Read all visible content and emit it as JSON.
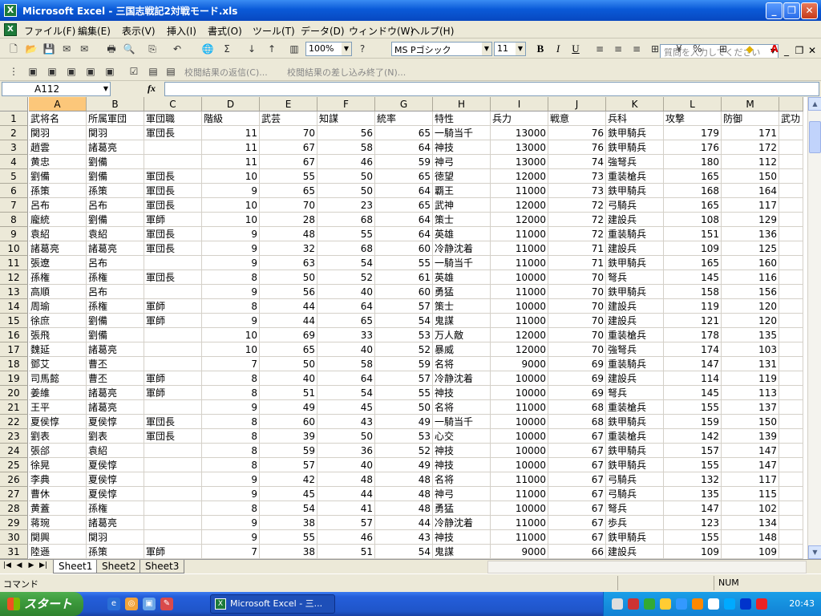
{
  "window": {
    "title": "Microsoft Excel - 三国志戦記2対戦モード.xls"
  },
  "menu": [
    "ファイル(F)",
    "編集(E)",
    "表示(V)",
    "挿入(I)",
    "書式(O)",
    "ツール(T)",
    "データ(D)",
    "ウィンドウ(W)",
    "ヘルプ(H)"
  ],
  "help_placeholder": "質問を入力してください",
  "toolbar": {
    "zoom": "100%",
    "font": "MS Pゴシック",
    "size": "11",
    "review_reply": "校閲結果の返信(C)...",
    "review_end": "校閲結果の差し込み終了(N)..."
  },
  "namebox": "A112",
  "fx": "fx",
  "columns": [
    "A",
    "B",
    "C",
    "D",
    "E",
    "F",
    "G",
    "H",
    "I",
    "J",
    "K",
    "L",
    "M",
    ""
  ],
  "rows": [
    [
      "1",
      "武将名",
      "所属軍団",
      "軍団職",
      "階級",
      "武芸",
      "知謀",
      "統率",
      "特性",
      "兵力",
      "戦意",
      "兵科",
      "攻撃",
      "防御",
      "武功"
    ],
    [
      "2",
      "関羽",
      "関羽",
      "軍団長",
      "11",
      "70",
      "56",
      "65",
      "一騎当千",
      "13000",
      "76",
      "鉄甲騎兵",
      "179",
      "171",
      ""
    ],
    [
      "3",
      "趙雲",
      "諸葛亮",
      "",
      "11",
      "67",
      "58",
      "64",
      "神技",
      "13000",
      "76",
      "鉄甲騎兵",
      "176",
      "172",
      ""
    ],
    [
      "4",
      "黄忠",
      "劉備",
      "",
      "11",
      "67",
      "46",
      "59",
      "神弓",
      "13000",
      "74",
      "強弩兵",
      "180",
      "112",
      ""
    ],
    [
      "5",
      "劉備",
      "劉備",
      "軍団長",
      "10",
      "55",
      "50",
      "65",
      "徳望",
      "12000",
      "73",
      "重装槍兵",
      "165",
      "150",
      ""
    ],
    [
      "6",
      "孫策",
      "孫策",
      "軍団長",
      "9",
      "65",
      "50",
      "64",
      "覇王",
      "11000",
      "73",
      "鉄甲騎兵",
      "168",
      "164",
      ""
    ],
    [
      "7",
      "呂布",
      "呂布",
      "軍団長",
      "10",
      "70",
      "23",
      "65",
      "武神",
      "12000",
      "72",
      "弓騎兵",
      "165",
      "117",
      ""
    ],
    [
      "8",
      "龐統",
      "劉備",
      "軍師",
      "10",
      "28",
      "68",
      "64",
      "策士",
      "12000",
      "72",
      "建設兵",
      "108",
      "129",
      ""
    ],
    [
      "9",
      "袁紹",
      "袁紹",
      "軍団長",
      "9",
      "48",
      "55",
      "64",
      "英雄",
      "11000",
      "72",
      "重装騎兵",
      "151",
      "136",
      ""
    ],
    [
      "10",
      "諸葛亮",
      "諸葛亮",
      "軍団長",
      "9",
      "32",
      "68",
      "60",
      "冷静沈着",
      "11000",
      "71",
      "建設兵",
      "109",
      "125",
      ""
    ],
    [
      "11",
      "張遼",
      "呂布",
      "",
      "9",
      "63",
      "54",
      "55",
      "一騎当千",
      "11000",
      "71",
      "鉄甲騎兵",
      "165",
      "160",
      ""
    ],
    [
      "12",
      "孫権",
      "孫権",
      "軍団長",
      "8",
      "50",
      "52",
      "61",
      "英雄",
      "10000",
      "70",
      "弩兵",
      "145",
      "116",
      ""
    ],
    [
      "13",
      "高順",
      "呂布",
      "",
      "9",
      "56",
      "40",
      "60",
      "勇猛",
      "11000",
      "70",
      "鉄甲騎兵",
      "158",
      "156",
      ""
    ],
    [
      "14",
      "周瑜",
      "孫権",
      "軍師",
      "8",
      "44",
      "64",
      "57",
      "策士",
      "10000",
      "70",
      "建設兵",
      "119",
      "120",
      ""
    ],
    [
      "15",
      "徐庶",
      "劉備",
      "軍師",
      "9",
      "44",
      "65",
      "54",
      "鬼謀",
      "11000",
      "70",
      "建設兵",
      "121",
      "120",
      ""
    ],
    [
      "16",
      "張飛",
      "劉備",
      "",
      "10",
      "69",
      "33",
      "53",
      "万人敵",
      "12000",
      "70",
      "重装槍兵",
      "178",
      "135",
      ""
    ],
    [
      "17",
      "魏延",
      "諸葛亮",
      "",
      "10",
      "65",
      "40",
      "52",
      "暴威",
      "12000",
      "70",
      "強弩兵",
      "174",
      "103",
      ""
    ],
    [
      "18",
      "鄧艾",
      "曹丕",
      "",
      "7",
      "50",
      "58",
      "59",
      "名将",
      "9000",
      "69",
      "重装騎兵",
      "147",
      "131",
      ""
    ],
    [
      "19",
      "司馬懿",
      "曹丕",
      "軍師",
      "8",
      "40",
      "64",
      "57",
      "冷静沈着",
      "10000",
      "69",
      "建設兵",
      "114",
      "119",
      ""
    ],
    [
      "20",
      "姜維",
      "諸葛亮",
      "軍師",
      "8",
      "51",
      "54",
      "55",
      "神技",
      "10000",
      "69",
      "弩兵",
      "145",
      "113",
      ""
    ],
    [
      "21",
      "王平",
      "諸葛亮",
      "",
      "9",
      "49",
      "45",
      "50",
      "名将",
      "11000",
      "68",
      "重装槍兵",
      "155",
      "137",
      ""
    ],
    [
      "22",
      "夏侯惇",
      "夏侯惇",
      "軍団長",
      "8",
      "60",
      "43",
      "49",
      "一騎当千",
      "10000",
      "68",
      "鉄甲騎兵",
      "159",
      "150",
      ""
    ],
    [
      "23",
      "劉表",
      "劉表",
      "軍団長",
      "8",
      "39",
      "50",
      "53",
      "心交",
      "10000",
      "67",
      "重装槍兵",
      "142",
      "139",
      ""
    ],
    [
      "24",
      "張郃",
      "袁紹",
      "",
      "8",
      "59",
      "36",
      "52",
      "神技",
      "10000",
      "67",
      "鉄甲騎兵",
      "157",
      "147",
      ""
    ],
    [
      "25",
      "徐晃",
      "夏侯惇",
      "",
      "8",
      "57",
      "40",
      "49",
      "神技",
      "10000",
      "67",
      "鉄甲騎兵",
      "155",
      "147",
      ""
    ],
    [
      "26",
      "李典",
      "夏侯惇",
      "",
      "9",
      "42",
      "48",
      "48",
      "名将",
      "11000",
      "67",
      "弓騎兵",
      "132",
      "117",
      ""
    ],
    [
      "27",
      "曹休",
      "夏侯惇",
      "",
      "9",
      "45",
      "44",
      "48",
      "神弓",
      "11000",
      "67",
      "弓騎兵",
      "135",
      "115",
      ""
    ],
    [
      "28",
      "黄蓋",
      "孫権",
      "",
      "8",
      "54",
      "41",
      "48",
      "勇猛",
      "10000",
      "67",
      "弩兵",
      "147",
      "102",
      ""
    ],
    [
      "29",
      "蒋琬",
      "諸葛亮",
      "",
      "9",
      "38",
      "57",
      "44",
      "冷静沈着",
      "11000",
      "67",
      "歩兵",
      "123",
      "134",
      ""
    ],
    [
      "30",
      "関興",
      "関羽",
      "",
      "9",
      "55",
      "46",
      "43",
      "神技",
      "11000",
      "67",
      "鉄甲騎兵",
      "155",
      "148",
      ""
    ],
    [
      "31",
      "陸遜",
      "孫策",
      "軍師",
      "7",
      "38",
      "51",
      "54",
      "鬼謀",
      "9000",
      "66",
      "建設兵",
      "109",
      "109",
      ""
    ]
  ],
  "sheets": [
    "Sheet1",
    "Sheet2",
    "Sheet3"
  ],
  "status": {
    "mode": "コマンド",
    "num": "NUM"
  },
  "taskbar": {
    "start": "スタート",
    "task": "Microsoft Excel - 三...",
    "clock": "20:43"
  }
}
